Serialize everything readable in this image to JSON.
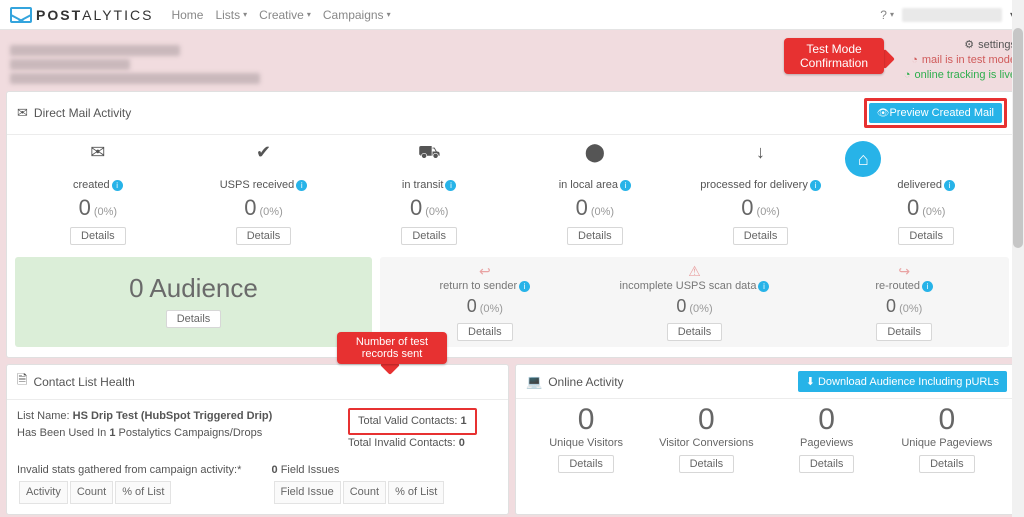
{
  "nav": {
    "brand_prefix": "POST",
    "brand_suffix": "ALYTICS",
    "items": [
      "Home",
      "Lists",
      "Creative",
      "Campaigns"
    ],
    "with_caret": [
      false,
      true,
      true,
      true
    ],
    "help_label": "?"
  },
  "test_mode": {
    "callout_l1": "Test Mode",
    "callout_l2": "Confirmation",
    "settings_label": "settings",
    "mail_status": "mail is in test mode",
    "tracking_status": "online tracking is live"
  },
  "activity": {
    "title": "Direct Mail Activity",
    "preview_btn": "Preview Created Mail",
    "cards": [
      {
        "icon": "✉",
        "label": "created",
        "count": "0",
        "pct": "(0%)"
      },
      {
        "icon": "✔",
        "label": "USPS received",
        "count": "0",
        "pct": "(0%)"
      },
      {
        "icon": "⛟",
        "label": "in transit",
        "count": "0",
        "pct": "(0%)"
      },
      {
        "icon": "⬤",
        "label": "in local area",
        "count": "0",
        "pct": "(0%)"
      },
      {
        "icon": "↓",
        "label": "processed for delivery",
        "count": "0",
        "pct": "(0%)"
      },
      {
        "icon": "⌂",
        "label": "delivered",
        "count": "0",
        "pct": "(0%)",
        "delivered": true
      }
    ],
    "details_label": "Details",
    "audience": {
      "count": "0",
      "label": "Audience"
    },
    "warnings": [
      {
        "icon": "↩",
        "label": "return to sender",
        "count": "0",
        "pct": "(0%)"
      },
      {
        "icon": "⚠",
        "label": "incomplete USPS scan data",
        "count": "0",
        "pct": "(0%)"
      },
      {
        "icon": "↪",
        "label": "re-routed",
        "count": "0",
        "pct": "(0%)"
      }
    ]
  },
  "list_health": {
    "title": "Contact List Health",
    "callout_l1": "Number of test",
    "callout_l2": "records sent",
    "list_name_label": "List Name:",
    "list_name_value": "HS Drip Test (HubSpot Triggered Drip)",
    "total_valid_label": "Total Valid Contacts:",
    "total_valid_value": "1",
    "usage_prefix": "Has Been Used In",
    "usage_bold": "1",
    "usage_suffix": "Postalytics Campaigns/Drops",
    "total_invalid_label": "Total Invalid Contacts:",
    "total_invalid_value": "0",
    "stats_note": "Invalid stats gathered from campaign activity:*",
    "field_issues_prefix": "0",
    "field_issues_suffix": "Field Issues",
    "tbl1_headers": [
      "Activity",
      "Count",
      "% of List"
    ],
    "tbl2_headers": [
      "Field Issue",
      "Count",
      "% of List"
    ]
  },
  "online": {
    "title": "Online Activity",
    "download_btn": "Download Audience Including pURLs",
    "metrics": [
      {
        "num": "0",
        "label": "Unique Visitors"
      },
      {
        "num": "0",
        "label": "Visitor Conversions"
      },
      {
        "num": "0",
        "label": "Pageviews"
      },
      {
        "num": "0",
        "label": "Unique Pageviews"
      }
    ],
    "details_label": "Details"
  }
}
